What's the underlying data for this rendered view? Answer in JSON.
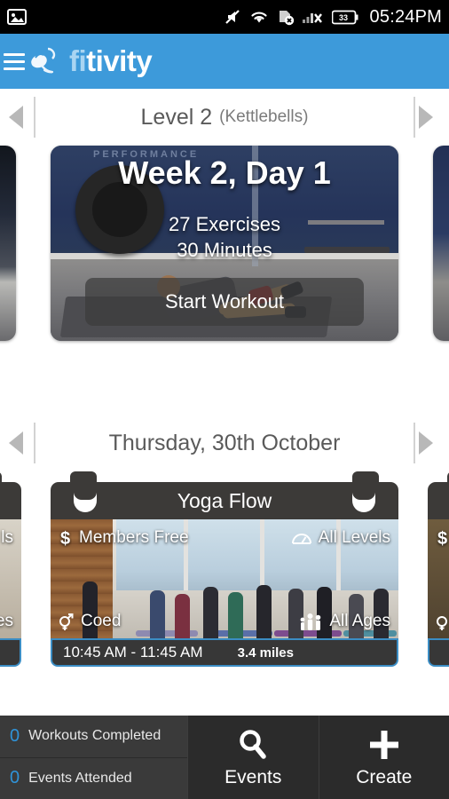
{
  "statusbar": {
    "time": "05:24PM",
    "battery_level": "33",
    "icons": [
      "image-icon",
      "mute-icon",
      "wifi-icon",
      "sim-card-off-icon",
      "signal-off-icon",
      "battery-icon"
    ]
  },
  "appbar": {
    "menu_icon": "hamburger-menu-icon",
    "logo_icon": "kettlebell-logo-icon",
    "brand_prefix": "fi",
    "brand_suffix": "tivity",
    "color": "#3d9ada"
  },
  "workout_section": {
    "prev_icon": "left-arrow-icon",
    "next_icon": "right-arrow-icon",
    "title": "Level 2",
    "subtitle": "(Kettlebells)",
    "card": {
      "title": "Week 2, Day 1",
      "exercises": "27 Exercises",
      "duration": "30 Minutes",
      "button_label": "Start Workout",
      "background_text": "PERFORMANCE"
    }
  },
  "events_section": {
    "prev_icon": "left-arrow-icon",
    "next_icon": "right-arrow-icon",
    "date_title": "Thursday, 30th October",
    "card": {
      "title": "Yoga Flow",
      "price_icon": "dollar-icon",
      "price": "Members Free",
      "level_icon": "gauge-icon",
      "level": "All Levels",
      "gender_icon": "coed-gender-icon",
      "gender": "Coed",
      "ages_icon": "family-group-icon",
      "ages": "All Ages",
      "time": "10:45 AM - 11:45 AM",
      "distance": "3.4 miles",
      "accent_color": "#3b8dc4"
    },
    "peek_left": {
      "level": "ls",
      "ages": "es"
    },
    "peek_right": {
      "price_icon": "dollar-icon",
      "gender_icon": "coed-gender-icon"
    }
  },
  "bottombar": {
    "stats": [
      {
        "count": "0",
        "label": "Workouts Completed"
      },
      {
        "count": "0",
        "label": "Events Attended"
      }
    ],
    "buttons": [
      {
        "label": "Events",
        "icon": "search-icon"
      },
      {
        "label": "Create",
        "icon": "plus-icon"
      }
    ],
    "count_color": "#2f93d8"
  }
}
